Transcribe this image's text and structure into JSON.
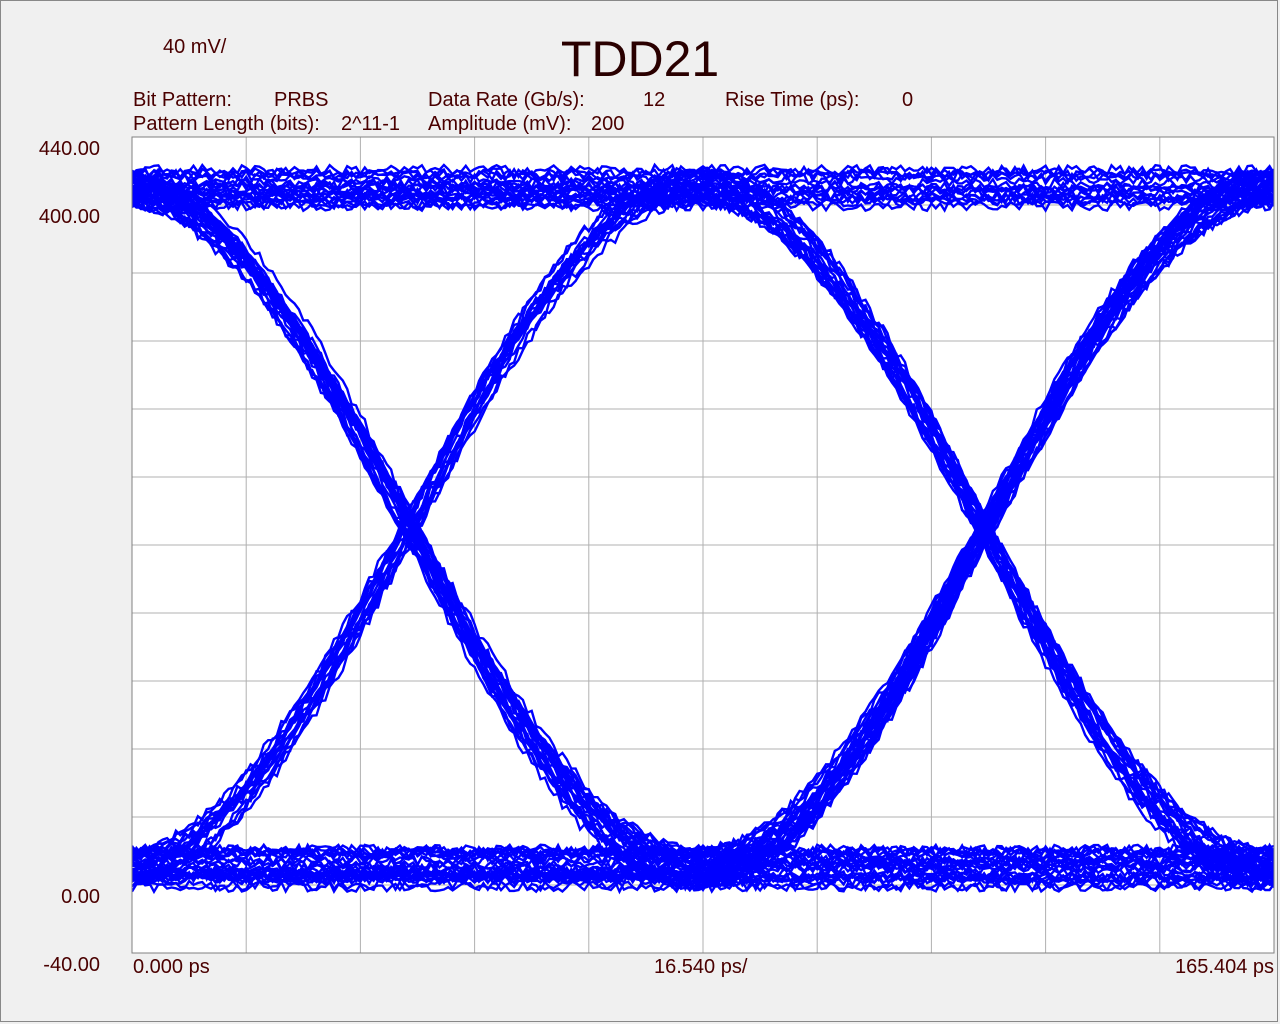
{
  "chart_data": {
    "type": "line",
    "title": "TDD21",
    "scale_label": "40 mV/",
    "info": {
      "bit_pattern_label": "Bit Pattern:",
      "bit_pattern_value": "PRBS",
      "pattern_length_label": "Pattern Length (bits):",
      "pattern_length_value": "2^11-1",
      "data_rate_label": "Data Rate (Gb/s):",
      "data_rate_value": "12",
      "amplitude_label": "Amplitude (mV):",
      "amplitude_value": "200",
      "rise_time_label": "Rise Time (ps):",
      "rise_time_value": "0"
    },
    "y_tick_labels": [
      "440.00",
      "400.00",
      "0.00",
      "-40.00"
    ],
    "x_tick_labels": [
      "0.000 ps",
      "16.540 ps/",
      "165.404 ps"
    ],
    "xlim": [
      0,
      165.404
    ],
    "ylim": [
      -40,
      440
    ],
    "grid": true,
    "grid_divisions": {
      "x": 10,
      "y": 12
    },
    "unit_interval_ps": 83.33,
    "crossings_ps": [
      40.2,
      123.5
    ],
    "levels_mV": {
      "low": 0,
      "high": 400,
      "crossing": 200
    },
    "trace_color": "#0000ff",
    "grid_color": "#b0b0b0",
    "text_color": "#4a0000"
  }
}
